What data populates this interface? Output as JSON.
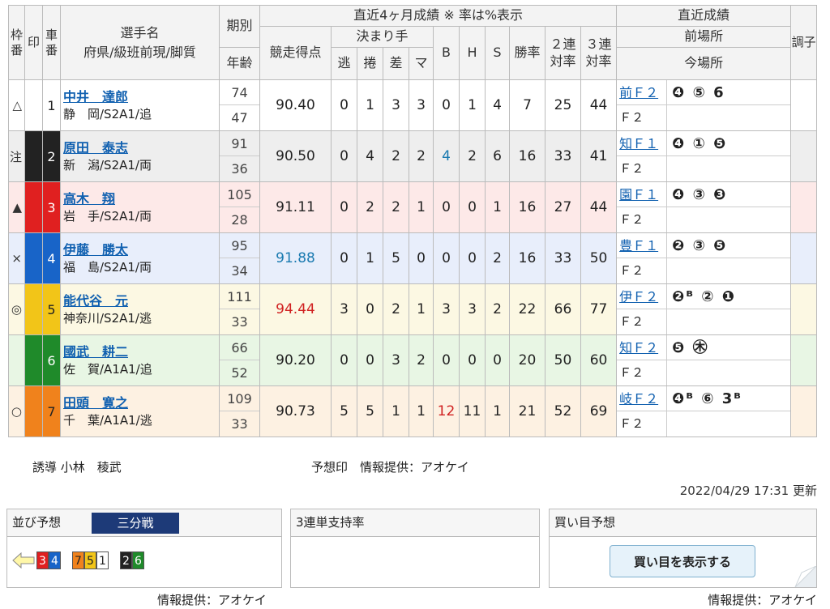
{
  "header": {
    "waku": "枠番",
    "shirushi": "印",
    "sha": "車番",
    "name1": "選手名",
    "name2": "府県/級班前現/脚質",
    "ki": "期別",
    "age": "年齢",
    "recent_title": "直近4ヶ月成績 ※ 率は%表示",
    "score": "競走得点",
    "kimarite": "決まり手",
    "k_nige": "逃",
    "k_makuri": "捲",
    "k_sashi": "差",
    "k_mark": "マ",
    "b": "B",
    "h": "H",
    "s": "S",
    "win": "勝率",
    "nirentai": "２連対率",
    "sanrentai": "３連対率",
    "recent_result": "直近成績",
    "prev_venue": "前場所",
    "cur_venue": "今場所",
    "condition": "調子"
  },
  "riders": [
    {
      "row_class": "r1",
      "mark": "△",
      "car": "1",
      "car_class": "c1",
      "name": "中井　達郎",
      "pref": "静　岡/S2A1/追",
      "ki": "74",
      "age": "47",
      "score": "90.40",
      "score_class": "",
      "nige": "0",
      "makuri": "1",
      "sashi": "3",
      "mark_k": "3",
      "b": "0",
      "b_class": "",
      "h": "1",
      "s": "4",
      "win": "7",
      "nirentai": "25",
      "sanrentai": "44",
      "prev_venue": "前Ｆ２",
      "prev_result": "❹ ⑤ 6",
      "prev_sup": [
        "",
        "",
        ""
      ],
      "cur_venue": "Ｆ２"
    },
    {
      "row_class": "r2",
      "mark": "注",
      "car": "2",
      "car_class": "c2",
      "name": "原田　泰志",
      "pref": "新　潟/S2A1/両",
      "ki": "91",
      "age": "36",
      "score": "90.50",
      "score_class": "",
      "nige": "0",
      "makuri": "4",
      "sashi": "2",
      "mark_k": "2",
      "b": "4",
      "b_class": "blue",
      "h": "2",
      "s": "6",
      "win": "16",
      "nirentai": "33",
      "sanrentai": "41",
      "prev_venue": "知Ｆ１",
      "prev_result": "❹ ① ❺",
      "cur_venue": "Ｆ２"
    },
    {
      "row_class": "r3",
      "mark": "▲",
      "car": "3",
      "car_class": "c3",
      "name": "高木　翔",
      "pref": "岩　手/S2A1/両",
      "ki": "105",
      "age": "28",
      "score": "91.11",
      "score_class": "",
      "nige": "0",
      "makuri": "2",
      "sashi": "2",
      "mark_k": "1",
      "b": "0",
      "b_class": "",
      "h": "0",
      "s": "1",
      "win": "16",
      "nirentai": "27",
      "sanrentai": "44",
      "prev_venue": "園Ｆ１",
      "prev_result": "❹ ③ ❸",
      "cur_venue": "Ｆ２"
    },
    {
      "row_class": "r4",
      "mark": "×",
      "car": "4",
      "car_class": "c4",
      "name": "伊藤　勝太",
      "pref": "福　島/S2A1/両",
      "ki": "95",
      "age": "34",
      "score": "91.88",
      "score_class": "blue",
      "nige": "0",
      "makuri": "1",
      "sashi": "5",
      "mark_k": "0",
      "b": "0",
      "b_class": "",
      "h": "0",
      "s": "2",
      "win": "16",
      "nirentai": "33",
      "sanrentai": "50",
      "prev_venue": "豊Ｆ１",
      "prev_result": "❷ ③ ❺",
      "cur_venue": "Ｆ２"
    },
    {
      "row_class": "r5",
      "mark": "◎",
      "car": "5",
      "car_class": "c5",
      "name": "能代谷　元",
      "pref": "神奈川/S2A1/逃",
      "ki": "111",
      "age": "33",
      "score": "94.44",
      "score_class": "red",
      "nige": "3",
      "makuri": "0",
      "sashi": "2",
      "mark_k": "1",
      "b": "3",
      "b_class": "",
      "h": "3",
      "s": "2",
      "win": "22",
      "nirentai": "66",
      "sanrentai": "77",
      "prev_venue": "伊Ｆ２",
      "prev_result": "❷ᴮ ② ❶",
      "cur_venue": "Ｆ２"
    },
    {
      "row_class": "r6",
      "mark": "",
      "car": "6",
      "car_class": "c6",
      "name": "國武　耕二",
      "pref": "佐　賀/A1A1/追",
      "ki": "66",
      "age": "52",
      "score": "90.20",
      "score_class": "",
      "nige": "0",
      "makuri": "0",
      "sashi": "3",
      "mark_k": "2",
      "b": "0",
      "b_class": "",
      "h": "0",
      "s": "0",
      "win": "20",
      "nirentai": "50",
      "sanrentai": "60",
      "prev_venue": "知Ｆ２",
      "prev_result": "❺ ㊍",
      "cur_venue": "Ｆ２"
    },
    {
      "row_class": "r7",
      "mark": "○",
      "car": "7",
      "car_class": "c7",
      "name": "田頭　寛之",
      "pref": "千　葉/A1A1/逃",
      "ki": "109",
      "age": "33",
      "score": "90.73",
      "score_class": "",
      "nige": "5",
      "makuri": "5",
      "sashi": "1",
      "mark_k": "1",
      "b": "12",
      "b_class": "red",
      "h": "11",
      "s": "1",
      "win": "21",
      "nirentai": "52",
      "sanrentai": "69",
      "prev_venue": "岐Ｆ２",
      "prev_result": "❹ᴮ ⑥ 3ᴮ",
      "cur_venue": "Ｆ２"
    }
  ],
  "lead": "誘導 小林　稜武",
  "mark_source": "予想印　情報提供：アオケイ",
  "updated": "2022/04/29 17:31 更新",
  "panel_lineup": {
    "title": "並び予想",
    "tag": "三分戦",
    "groups": [
      [
        "3",
        "4"
      ],
      [
        "7",
        "5",
        "1"
      ],
      [
        "2",
        "6"
      ]
    ]
  },
  "panel_support": {
    "title": "3連単支持率"
  },
  "panel_buy": {
    "title": "買い目予想",
    "button": "買い目を表示する"
  },
  "source_left": "情報提供：アオケイ",
  "source_right": "情報提供：アオケイ",
  "colors": {
    "c1": "#ffffff",
    "c2": "#222222",
    "c3": "#e02020",
    "c4": "#1864c8",
    "c5": "#f2c518",
    "c6": "#1f8a2a",
    "c7": "#f0821c",
    "accent_blue": "#1a7ab0",
    "accent_red": "#d02020",
    "tag_bg": "#1d3a78"
  }
}
